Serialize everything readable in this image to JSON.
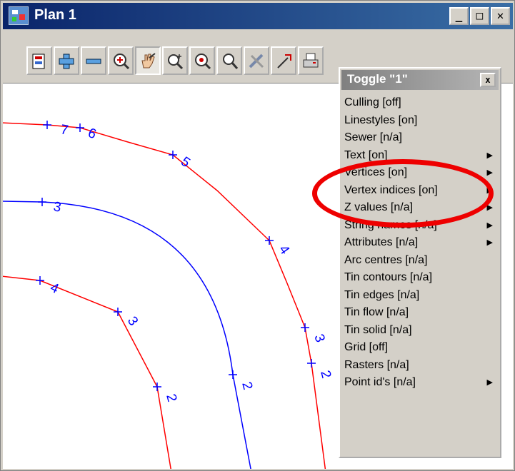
{
  "window": {
    "title": "Plan 1",
    "controls": {
      "minimize": "_",
      "maximize": "□",
      "close": "✕"
    }
  },
  "toolbar": {
    "buttons": [
      {
        "name": "plot-icon"
      },
      {
        "name": "zoom-in-plus-icon"
      },
      {
        "name": "zoom-out-minus-icon"
      },
      {
        "name": "zoom-extent-icon"
      },
      {
        "name": "pan-hand-icon",
        "pressed": true
      },
      {
        "name": "zoom-window-icon"
      },
      {
        "name": "zoom-centre-icon"
      },
      {
        "name": "zoom-magnify-icon"
      },
      {
        "name": "tools-icon"
      },
      {
        "name": "pick-icon"
      },
      {
        "name": "print-icon"
      }
    ]
  },
  "menu": {
    "title": "Toggle \"1\"",
    "close": "x",
    "items": [
      {
        "label": "Culling [off]",
        "submenu": false
      },
      {
        "label": "Linestyles [on]",
        "submenu": false
      },
      {
        "label": "Sewer [n/a]",
        "submenu": false
      },
      {
        "label": "Text [on]",
        "submenu": true
      },
      {
        "label": "Vertices [on]",
        "submenu": true
      },
      {
        "label": "Vertex indices [on]",
        "submenu": true
      },
      {
        "label": "Z values [n/a]",
        "submenu": true
      },
      {
        "label": "String names [n/a]",
        "submenu": true
      },
      {
        "label": "Attributes [n/a]",
        "submenu": true
      },
      {
        "label": "Arc centres [n/a]",
        "submenu": false
      },
      {
        "label": "Tin contours [n/a]",
        "submenu": false
      },
      {
        "label": "Tin edges [n/a]",
        "submenu": false
      },
      {
        "label": "Tin flow [n/a]",
        "submenu": false
      },
      {
        "label": "Tin solid [n/a]",
        "submenu": false
      },
      {
        "label": "Grid [off]",
        "submenu": false
      },
      {
        "label": "Rasters [n/a]",
        "submenu": false
      },
      {
        "label": "Point id's [n/a]",
        "submenu": true
      }
    ]
  },
  "plan": {
    "colors": {
      "red_string": "#ff0000",
      "blue_string": "#0000ff",
      "highlight": "#ee0000"
    },
    "labels": {
      "outer_red": [
        "7",
        "6",
        "5",
        "4",
        "3",
        "2"
      ],
      "blue": [
        "3",
        "2"
      ],
      "inner_red": [
        "4",
        "3",
        "2"
      ]
    }
  }
}
